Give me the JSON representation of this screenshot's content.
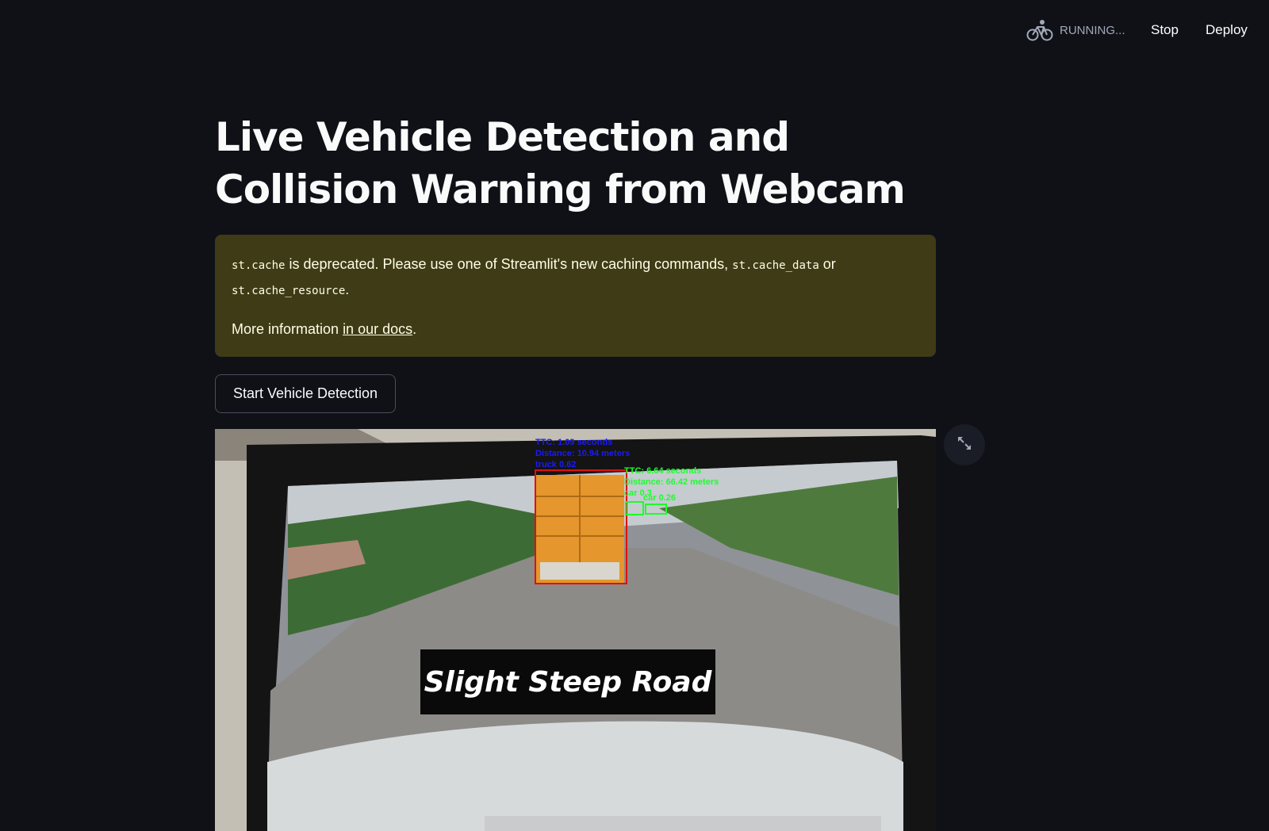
{
  "header": {
    "status_text": "RUNNING...",
    "stop_label": "Stop",
    "deploy_label": "Deploy"
  },
  "main": {
    "title": "Live Vehicle Detection and Collision Warning from Webcam",
    "alert": {
      "code_1": "st.cache",
      "text_1": " is deprecated. Please use one of Streamlit's new caching commands, ",
      "code_2": "st.cache_data",
      "text_2": " or ",
      "code_3": "st.cache_resource",
      "text_3": ".",
      "more_prefix": "More information ",
      "link_text": "in our docs",
      "more_suffix": "."
    },
    "start_button_label": "Start Vehicle Detection",
    "video": {
      "detection_truck": {
        "ttc": "TTC: 1.09 seconds",
        "distance": "Distance: 10.94 meters",
        "label": "truck 0.62"
      },
      "detection_cars": {
        "ttc": "TTC: 6.64 seconds",
        "distance": "Distance: 66.42 meters",
        "label": "car 0.3",
        "label_2": "car 0.26"
      },
      "road_sign_text": "Slight Steep Road"
    }
  }
}
